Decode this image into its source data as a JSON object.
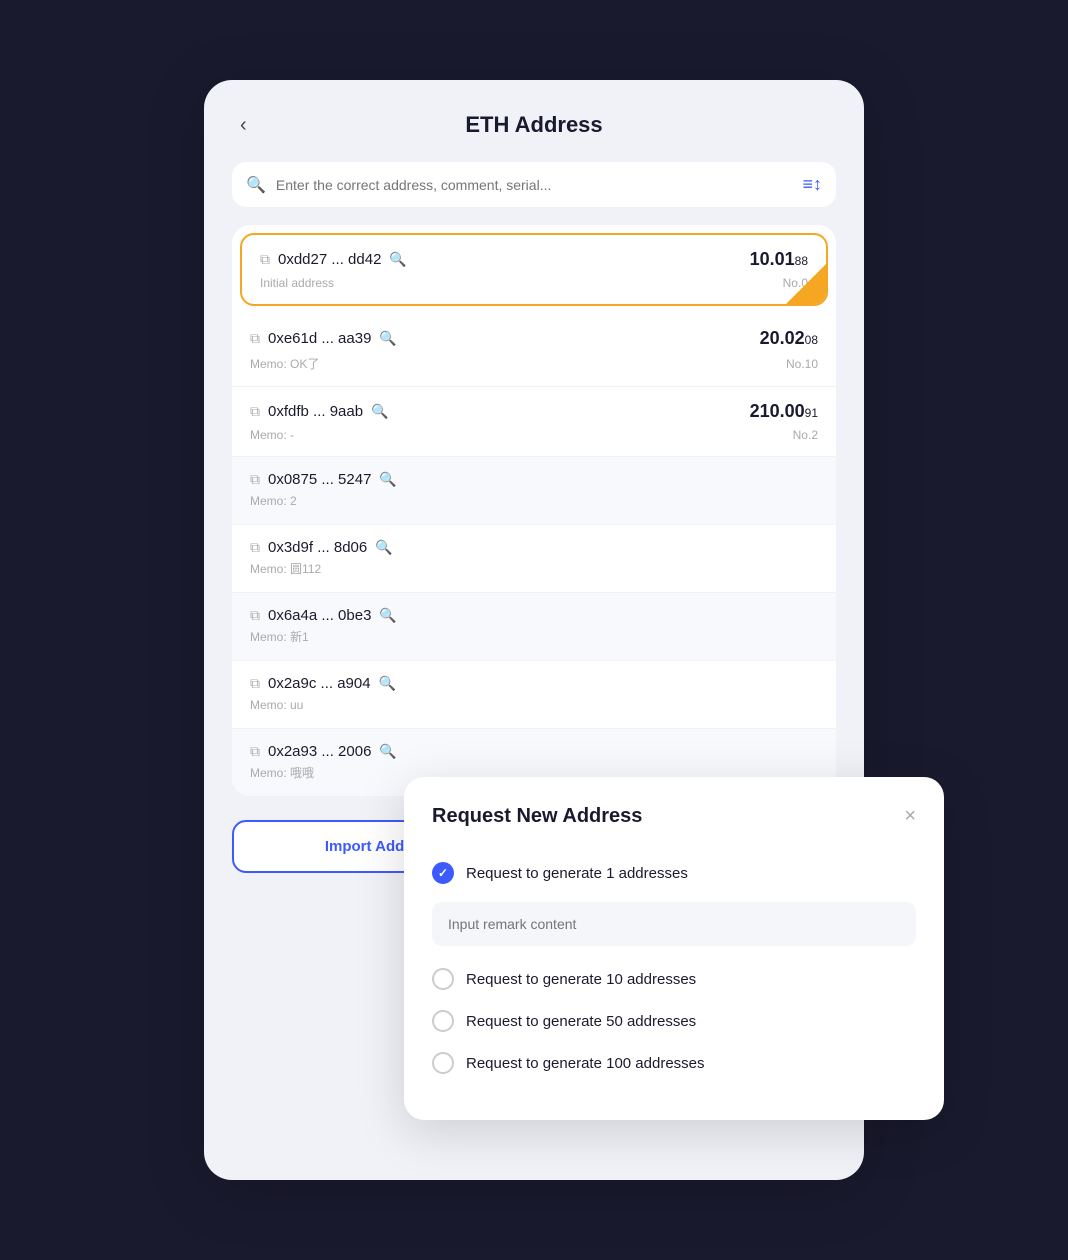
{
  "header": {
    "back_label": "‹",
    "title": "ETH Address"
  },
  "search": {
    "placeholder": "Enter the correct address, comment, serial..."
  },
  "filter_icon": "≡↕",
  "addresses": [
    {
      "address": "0xdd27 ... dd42",
      "memo": "Initial address",
      "amount_main": "10.01",
      "amount_sub": "88",
      "no": "No.0",
      "active": true
    },
    {
      "address": "0xe61d ... aa39",
      "memo": "Memo: OK了",
      "amount_main": "20.02",
      "amount_sub": "08",
      "no": "No.10",
      "active": false
    },
    {
      "address": "0xfdfb ... 9aab",
      "memo": "Memo: -",
      "amount_main": "210.00",
      "amount_sub": "91",
      "no": "No.2",
      "active": false
    },
    {
      "address": "0x0875 ... 5247",
      "memo": "Memo: 2",
      "amount_main": "",
      "amount_sub": "",
      "no": "",
      "active": false
    },
    {
      "address": "0x3d9f ... 8d06",
      "memo": "Memo: 圆112",
      "amount_main": "",
      "amount_sub": "",
      "no": "",
      "active": false
    },
    {
      "address": "0x6a4a ... 0be3",
      "memo": "Memo: 新1",
      "amount_main": "",
      "amount_sub": "",
      "no": "",
      "active": false
    },
    {
      "address": "0x2a9c ... a904",
      "memo": "Memo: uu",
      "amount_main": "",
      "amount_sub": "",
      "no": "",
      "active": false
    },
    {
      "address": "0x2a93 ... 2006",
      "memo": "Memo: 哦哦",
      "amount_main": "",
      "amount_sub": "",
      "no": "",
      "active": false
    }
  ],
  "buttons": {
    "import": "Import Address",
    "request": "Request New Address"
  },
  "modal": {
    "title": "Request New Address",
    "close_label": "×",
    "remark_placeholder": "Input remark content",
    "options": [
      {
        "label": "Request to generate 1 addresses",
        "checked": true
      },
      {
        "label": "Request to generate 10 addresses",
        "checked": false
      },
      {
        "label": "Request to generate 50 addresses",
        "checked": false
      },
      {
        "label": "Request to generate 100 addresses",
        "checked": false
      }
    ]
  }
}
